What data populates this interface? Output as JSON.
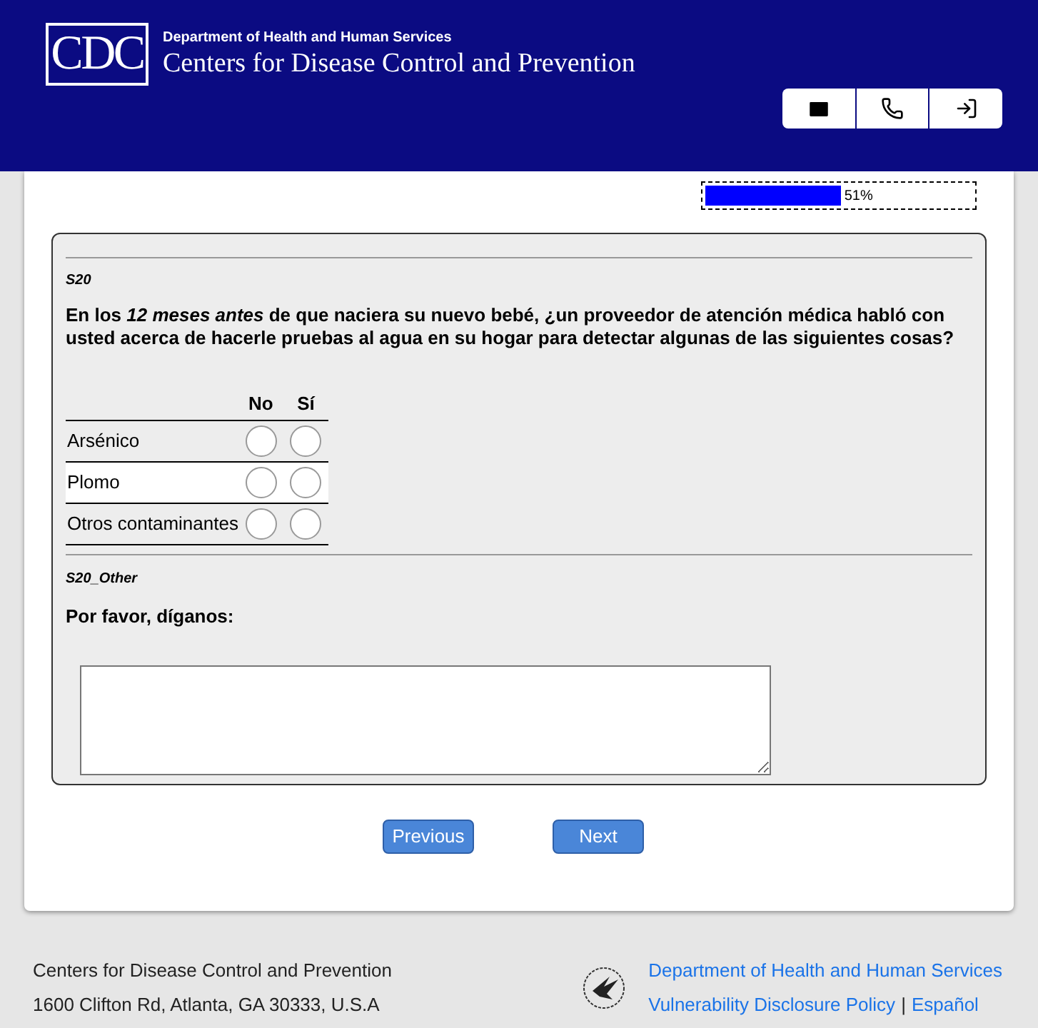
{
  "header": {
    "logo": "CDC",
    "department": "Department of Health and Human Services",
    "agency": "Centers for Disease Control and Prevention"
  },
  "progress": {
    "level": 0.51,
    "reading": "51%"
  },
  "question": {
    "code": "S20",
    "text": "En los *12 meses antes* de que naciera su nuevo bebé, ¿un proveedor de atención médica habló con usted acerca de hacerle pruebas al agua en su hogar para detectar algunas de las siguientes cosas?",
    "columns": [
      "No",
      "Sí"
    ],
    "rows": [
      {
        "label": "Arsénico",
        "options": [
          {
            "selected": false
          },
          {
            "selected": false
          }
        ]
      },
      {
        "label": "Plomo",
        "options": [
          {
            "selected": false
          },
          {
            "selected": false
          }
        ]
      },
      {
        "label": "Otros contaminantes",
        "options": [
          {
            "selected": false
          },
          {
            "selected": false
          }
        ]
      }
    ]
  },
  "other": {
    "code": "S20_Other",
    "text": "Por favor, díganos:"
  },
  "buttons": [
    "Previous",
    "Next"
  ],
  "footer": {
    "lines": [
      "Centers for Disease Control and Prevention",
      "1600 Clifton Rd, Atlanta, GA 30333, U.S.A"
    ],
    "links": [
      "Department of Health and Human Services",
      "Vulnerability Disclosure Policy",
      "Español"
    ],
    "separator": "|"
  }
}
